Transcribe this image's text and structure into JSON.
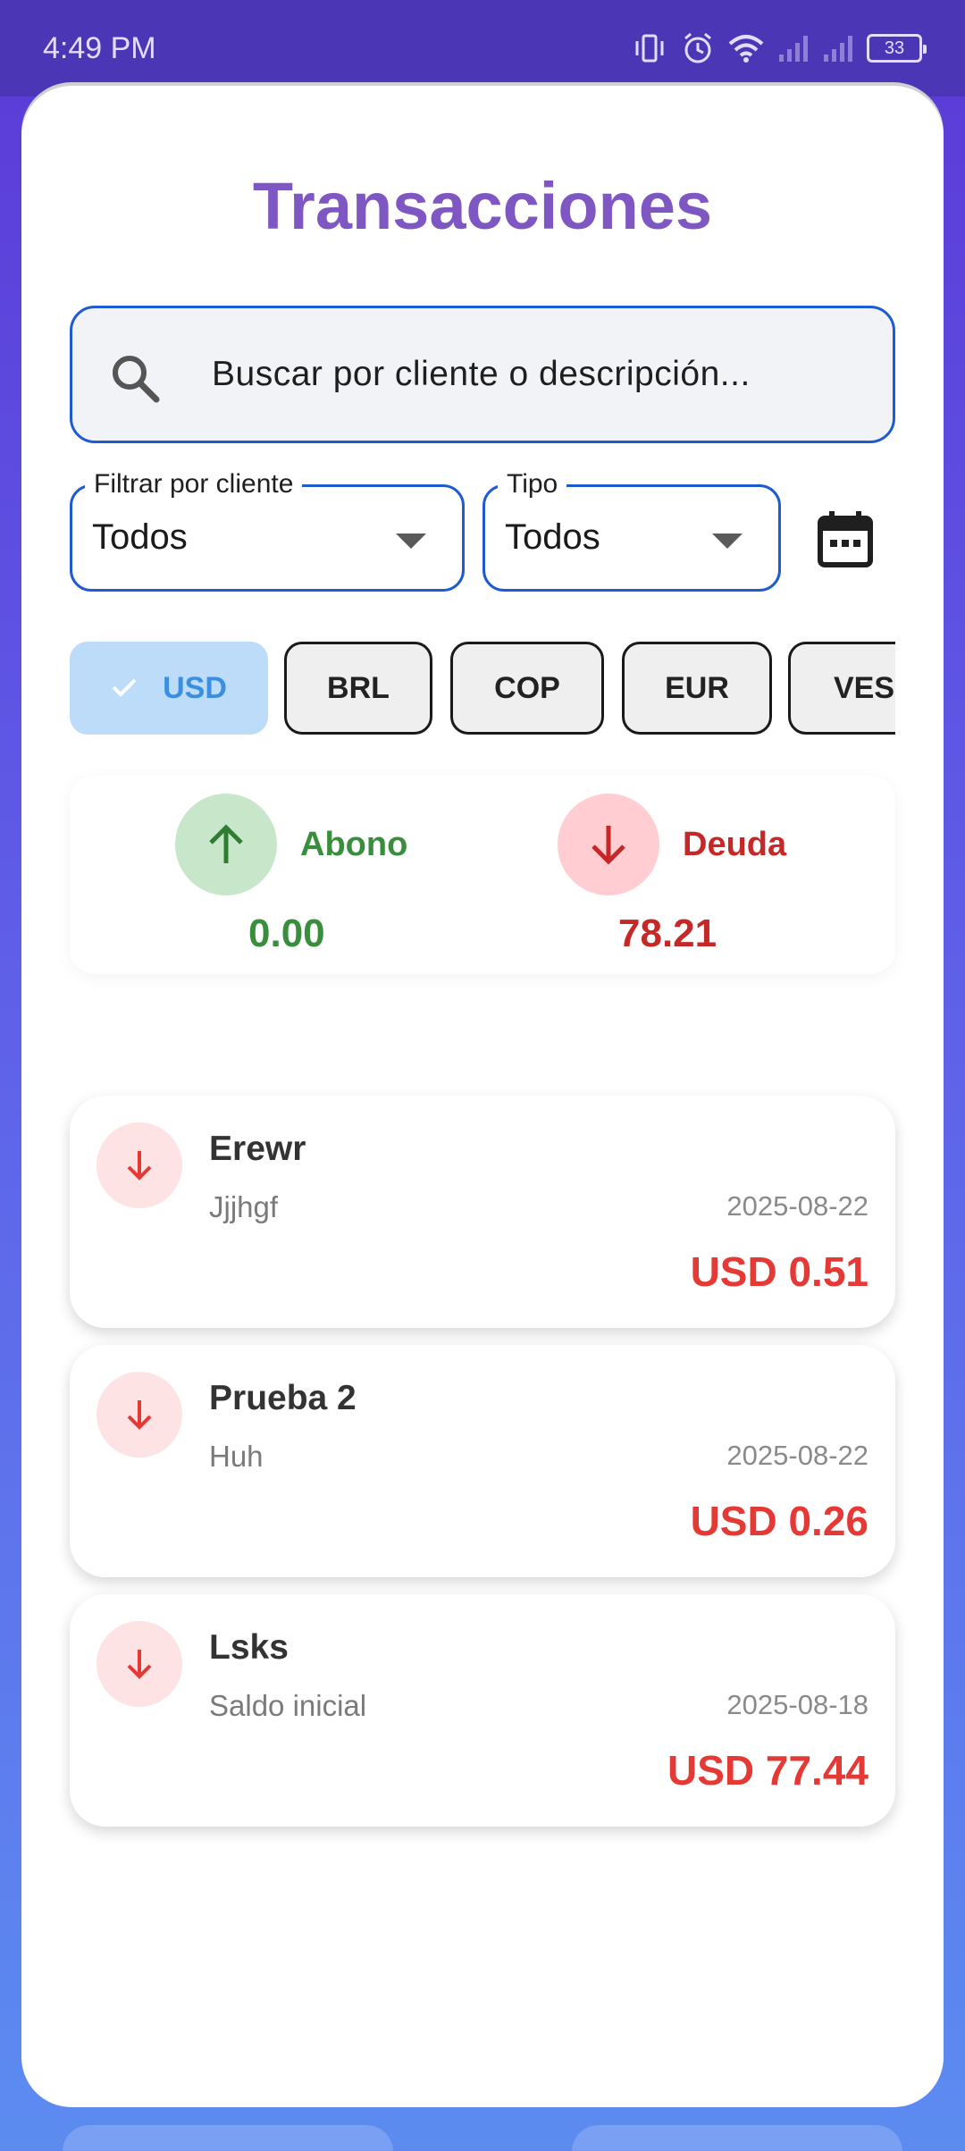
{
  "status_bar": {
    "time": "4:49 PM",
    "battery": "33",
    "icons": [
      "vibrate-icon",
      "alarm-icon",
      "wifi-icon",
      "signal-icon",
      "signal-icon",
      "battery-icon"
    ]
  },
  "page": {
    "title": "Transacciones"
  },
  "search": {
    "placeholder": "Buscar por cliente o descripción...",
    "icon": "search-icon"
  },
  "filters": {
    "client": {
      "label": "Filtrar por cliente",
      "value": "Todos"
    },
    "type": {
      "label": "Tipo",
      "value": "Todos"
    },
    "calendar_icon": "calendar-icon"
  },
  "currencies": {
    "items": [
      "USD",
      "BRL",
      "COP",
      "EUR",
      "VES"
    ],
    "selected": "USD"
  },
  "summary": {
    "credit": {
      "label": "Abono",
      "value": "0.00",
      "color": "#388e3c",
      "icon": "arrow-up-icon"
    },
    "debt": {
      "label": "Deuda",
      "value": "78.21",
      "color": "#c62828",
      "icon": "arrow-down-icon"
    }
  },
  "transactions": [
    {
      "name": "Erewr",
      "description": "Jjjhgf",
      "date": "2025-08-22",
      "amount": "USD 0.51",
      "icon": "arrow-down-icon"
    },
    {
      "name": "Prueba 2",
      "description": "Huh",
      "date": "2025-08-22",
      "amount": "USD 0.26",
      "icon": "arrow-down-icon"
    },
    {
      "name": "Lsks",
      "description": "Saldo inicial",
      "date": "2025-08-18",
      "amount": "USD 77.44",
      "icon": "arrow-down-icon"
    }
  ],
  "colors": {
    "accent": "#7e57c2",
    "field_border": "#1e5bd1",
    "debt": "#e53935",
    "credit": "#388e3c"
  }
}
